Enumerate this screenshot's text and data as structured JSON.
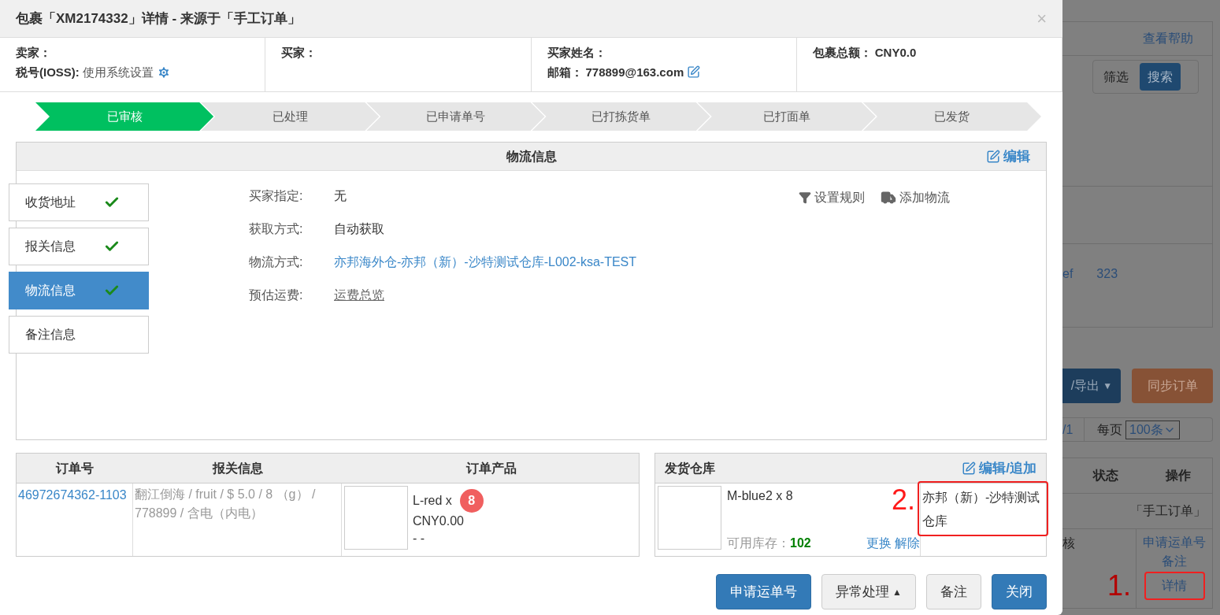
{
  "dialog": {
    "title": "包裹「XM2174332」详情 - 来源于「手工订单」",
    "close": "×"
  },
  "info": [
    {
      "lines": [
        {
          "label": "卖家：",
          "kind": "plain"
        },
        {
          "label": "税号(IOSS):",
          "value": "使用系统设置",
          "kind": "setting"
        }
      ]
    },
    {
      "lines": [
        {
          "label": "买家：",
          "kind": "plain"
        }
      ]
    },
    {
      "lines": [
        {
          "label": "买家姓名：",
          "kind": "plain"
        },
        {
          "label": "邮箱：",
          "value": "778899@163.com",
          "kind": "editable"
        }
      ]
    },
    {
      "lines": [
        {
          "label": "包裹总额：",
          "value": "CNY0.0",
          "kind": "plain"
        }
      ]
    }
  ],
  "steps": [
    {
      "label": "已审核",
      "selected": true
    },
    {
      "label": "已处理",
      "selected": false
    },
    {
      "label": "已申请单号",
      "selected": false
    },
    {
      "label": "已打拣货单",
      "selected": false
    },
    {
      "label": "已打面单",
      "selected": false
    },
    {
      "label": "已发货",
      "selected": false
    }
  ],
  "panel": {
    "title": "物流信息",
    "edit": "编辑"
  },
  "side_tabs": [
    {
      "label": "收货地址",
      "checked": true,
      "selected": false
    },
    {
      "label": "报关信息",
      "checked": true,
      "selected": false
    },
    {
      "label": "物流信息",
      "checked": true,
      "selected": true
    },
    {
      "label": "备注信息",
      "checked": false,
      "selected": false
    }
  ],
  "fields": [
    {
      "label": "买家指定:",
      "value": "无",
      "kind": "text"
    },
    {
      "label": "获取方式:",
      "value": "自动获取",
      "kind": "text"
    },
    {
      "label": "物流方式:",
      "value": "亦邦海外仓-亦邦（新）-沙特测试仓库-L002-ksa-TEST",
      "kind": "link"
    },
    {
      "label": "预估运费:",
      "value": "运费总览",
      "kind": "underline"
    }
  ],
  "actions": [
    {
      "label": "设置规则",
      "kind": "rule"
    },
    {
      "label": "添加物流",
      "kind": "shipping"
    }
  ],
  "orders": {
    "columns": [
      "订单号",
      "报关信息",
      "订单产品"
    ],
    "order_no": "46972674362-1103",
    "customs": "翻江倒海 / fruit / $ 5.0 / 8 （g） / 778899 / 含电（内电）",
    "product": "L-red x",
    "qty": "8",
    "price": "CNY0.00",
    "extra": "- -"
  },
  "warehouse": {
    "title": "发货仓库",
    "edit": "编辑/追加",
    "item": "M-blue2 x 8",
    "stock_label": "可用库存：",
    "stock": "102",
    "links": [
      "更换",
      "解除"
    ],
    "name": "亦邦（新）-沙特测试仓库",
    "annotation": "2."
  },
  "buttons": [
    {
      "label": "申请运单号",
      "kind": "primary"
    },
    {
      "label": "异常处理",
      "kind": "default",
      "caret": "▲"
    },
    {
      "label": "备注",
      "kind": "default"
    },
    {
      "label": "关闭",
      "kind": "primary"
    }
  ],
  "background": {
    "help": "查看帮助",
    "filter": "筛选",
    "search": "搜索",
    "cell_1": "ef",
    "cell_2": "323",
    "export": "/导出",
    "export_caret": "▼",
    "sync": "同步订单",
    "page": "/1",
    "per_page": "每页",
    "per_page_value": "100条",
    "columns": [
      "状态",
      "操作"
    ],
    "source": "「手工订单」",
    "status": "核",
    "row_actions": [
      "申请运单号",
      "备注",
      "详情"
    ],
    "annotation": "1."
  }
}
